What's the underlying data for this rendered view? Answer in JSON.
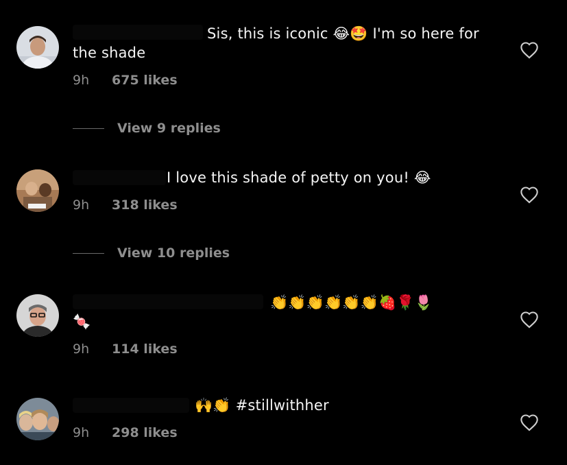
{
  "comments": [
    {
      "text": "Sis, this is iconic 😂🤩 I'm so here for the shade",
      "time": "9h",
      "likes": "675 likes",
      "replies": "View 9 replies"
    },
    {
      "text": "I love this shade of petty on you! 😂",
      "time": "9h",
      "likes": "318 likes",
      "replies": "View 10 replies"
    },
    {
      "text": "👏👏👏👏👏👏🍓🌹🌷\n🍬",
      "time": "9h",
      "likes": "114 likes"
    },
    {
      "text": "🙌👏 #stillwithher",
      "time": "9h",
      "likes": "298 likes"
    }
  ]
}
